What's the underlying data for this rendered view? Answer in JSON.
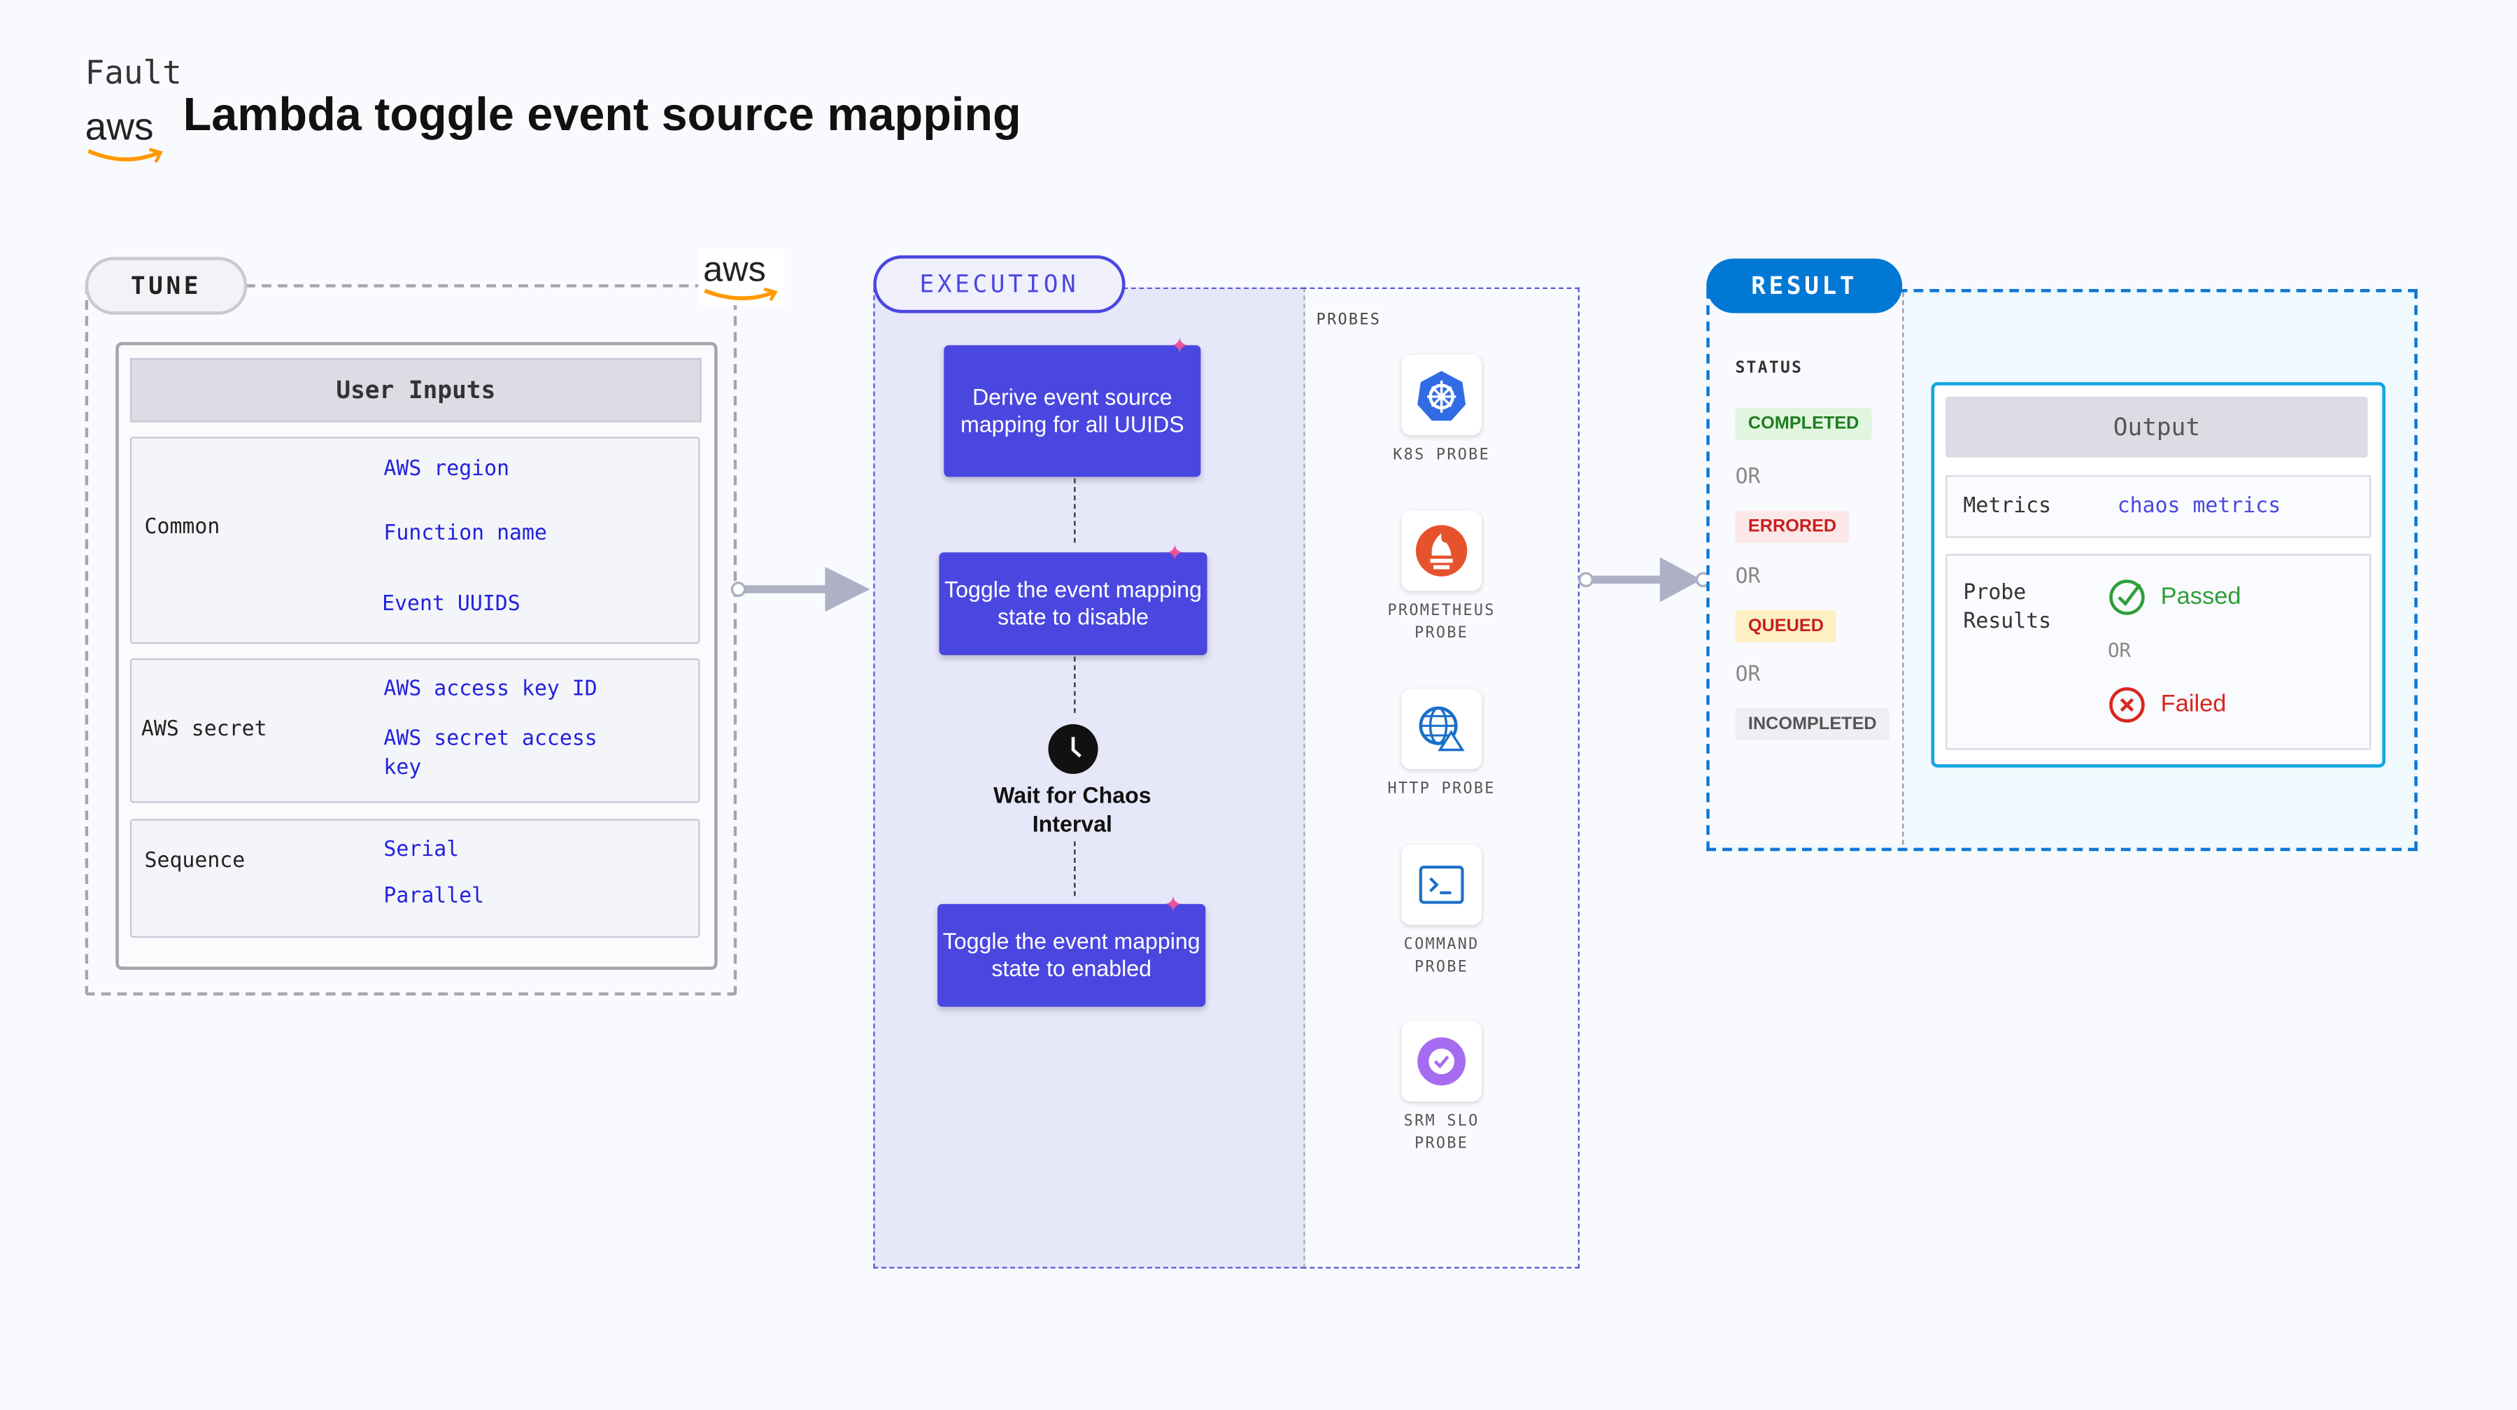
{
  "header": {
    "category": "Fault",
    "title": "Lambda toggle event source mapping",
    "logo_text": "aws"
  },
  "tune": {
    "label": "TUNE",
    "logo_text": "aws",
    "panel_title": "User Inputs",
    "groups": [
      {
        "label": "Common",
        "items": [
          "AWS region",
          "Function name",
          "Event UUIDS"
        ]
      },
      {
        "label": "AWS secret",
        "items": [
          "AWS access key ID",
          "AWS secret access key"
        ]
      },
      {
        "label": "Sequence",
        "items": [
          "Serial",
          "Parallel"
        ]
      }
    ]
  },
  "execution": {
    "label": "EXECUTION",
    "steps": [
      "Derive event source mapping for all UUIDS",
      "Toggle the event mapping state to disable",
      "Wait for Chaos Interval",
      "Toggle the event mapping state to enabled"
    ],
    "probes_label": "PROBES",
    "probes": [
      {
        "name": "K8S PROBE",
        "icon": "kubernetes-icon"
      },
      {
        "name": "PROMETHEUS PROBE",
        "icon": "prometheus-icon"
      },
      {
        "name": "HTTP PROBE",
        "icon": "globe-icon"
      },
      {
        "name": "COMMAND PROBE",
        "icon": "terminal-icon"
      },
      {
        "name": "SRM SLO PROBE",
        "icon": "slo-icon"
      }
    ]
  },
  "result": {
    "label": "RESULT",
    "status_label": "STATUS",
    "statuses": [
      "COMPLETED",
      "ERRORED",
      "QUEUED",
      "INCOMPLETED"
    ],
    "or": "OR",
    "output_title": "Output",
    "metrics_label": "Metrics",
    "metrics_value": "chaos metrics",
    "probe_results_label": "Probe Results",
    "passed": "Passed",
    "failed": "Failed"
  },
  "colors": {
    "accent": "#4a47e0",
    "result": "#0078d4",
    "passed": "#2e9e3a",
    "failed": "#d8261f",
    "aws_orange": "#f90"
  }
}
